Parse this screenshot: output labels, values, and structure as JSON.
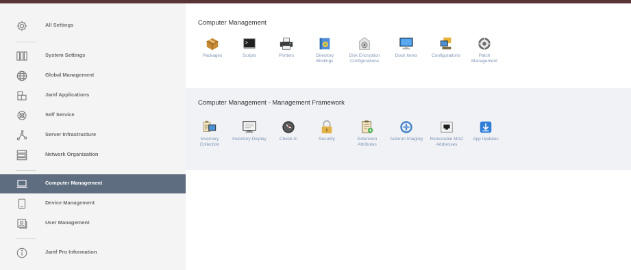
{
  "sidebar": {
    "items": [
      {
        "label": "All Settings",
        "icon": "gear-icon"
      },
      {
        "label": "System Settings",
        "icon": "server-racks-icon"
      },
      {
        "label": "Global Management",
        "icon": "globe-icon"
      },
      {
        "label": "Jamf Applications",
        "icon": "applications-icon"
      },
      {
        "label": "Self Service",
        "icon": "self-service-icon"
      },
      {
        "label": "Server Infrastructure",
        "icon": "infrastructure-icon"
      },
      {
        "label": "Network Organization",
        "icon": "network-icon"
      },
      {
        "label": "Computer Management",
        "icon": "laptop-icon",
        "active": true
      },
      {
        "label": "Device Management",
        "icon": "mobile-device-icon"
      },
      {
        "label": "User Management",
        "icon": "user-card-icon"
      },
      {
        "label": "Jamf Pro Information",
        "icon": "info-icon"
      }
    ]
  },
  "computer_management": {
    "title": "Computer Management",
    "tiles": [
      {
        "label": "Packages",
        "icon": "package-box-icon"
      },
      {
        "label": "Scripts",
        "icon": "terminal-icon"
      },
      {
        "label": "Printers",
        "icon": "printer-icon"
      },
      {
        "label": "Directory Bindings",
        "icon": "directory-bindings-icon"
      },
      {
        "label": "Disk Encryption Configurations",
        "icon": "disk-encryption-icon"
      },
      {
        "label": "Dock Items",
        "icon": "monitor-icon"
      },
      {
        "label": "Configurations",
        "icon": "configurations-icon"
      },
      {
        "label": "Patch Management",
        "icon": "patch-gear-icon"
      }
    ]
  },
  "management_framework": {
    "title": "Computer Management - Management Framework",
    "tiles": [
      {
        "label": "Inventory Collection",
        "icon": "inventory-collection-icon"
      },
      {
        "label": "Inventory Display",
        "icon": "inventory-display-icon"
      },
      {
        "label": "Check-In",
        "icon": "clock-icon"
      },
      {
        "label": "Security",
        "icon": "padlock-icon"
      },
      {
        "label": "Extension Attributes",
        "icon": "extension-attributes-icon"
      },
      {
        "label": "Autorun Imaging",
        "icon": "compass-icon"
      },
      {
        "label": "Removable MAC Addresses",
        "icon": "network-port-icon"
      },
      {
        "label": "App Updates",
        "icon": "app-update-download-icon"
      }
    ]
  },
  "colors": {
    "accent_active": "#5f6d80",
    "tile_label": "#7e94b4",
    "top_bar": "#5a3434"
  }
}
